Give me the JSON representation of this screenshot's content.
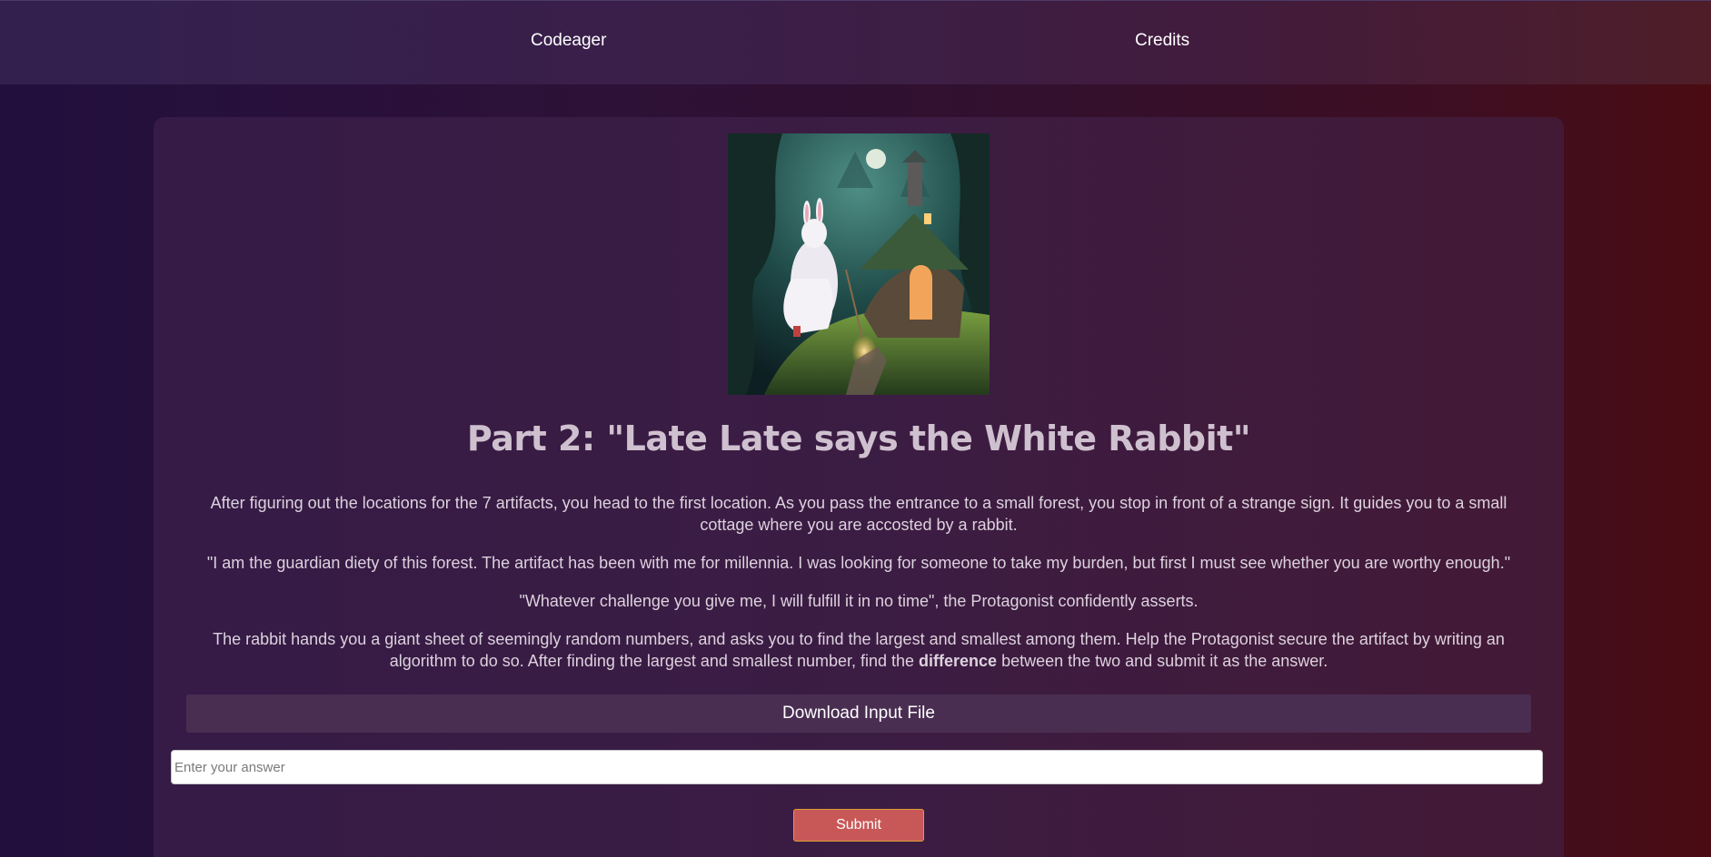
{
  "nav": {
    "codeager": "Codeager",
    "credits": "Credits"
  },
  "puzzle": {
    "title": "Part 2: \"Late Late says the White Rabbit\"",
    "p1": "After figuring out the locations for the 7 artifacts, you head to the first location. As you pass the entrance to a small forest, you stop in front of a strange sign. It guides you to a small cottage where you are accosted by a rabbit.",
    "p2": "\"I am the guardian diety of this forest. The artifact has been with me for millennia. I was looking for someone to take my burden, but first I must see whether you are worthy enough.\"",
    "p3": "\"Whatever challenge you give me, I will fulfill it in no time\", the Protagonist confidently asserts.",
    "p4_before": "The rabbit hands you a giant sheet of seemingly random numbers, and asks you to find the largest and smallest among them. Help the Protagonist secure the artifact by writing an algorithm to do so. After finding the largest and smallest number, find the ",
    "p4_bold": "difference",
    "p4_after": " between the two and submit it as the answer.",
    "download_label": "Download Input File",
    "answer_placeholder": "Enter your answer",
    "submit_label": "Submit"
  },
  "colors": {
    "submit": "#c85858",
    "submit_border": "#d9a037",
    "download_bg": "#4a2e52"
  }
}
